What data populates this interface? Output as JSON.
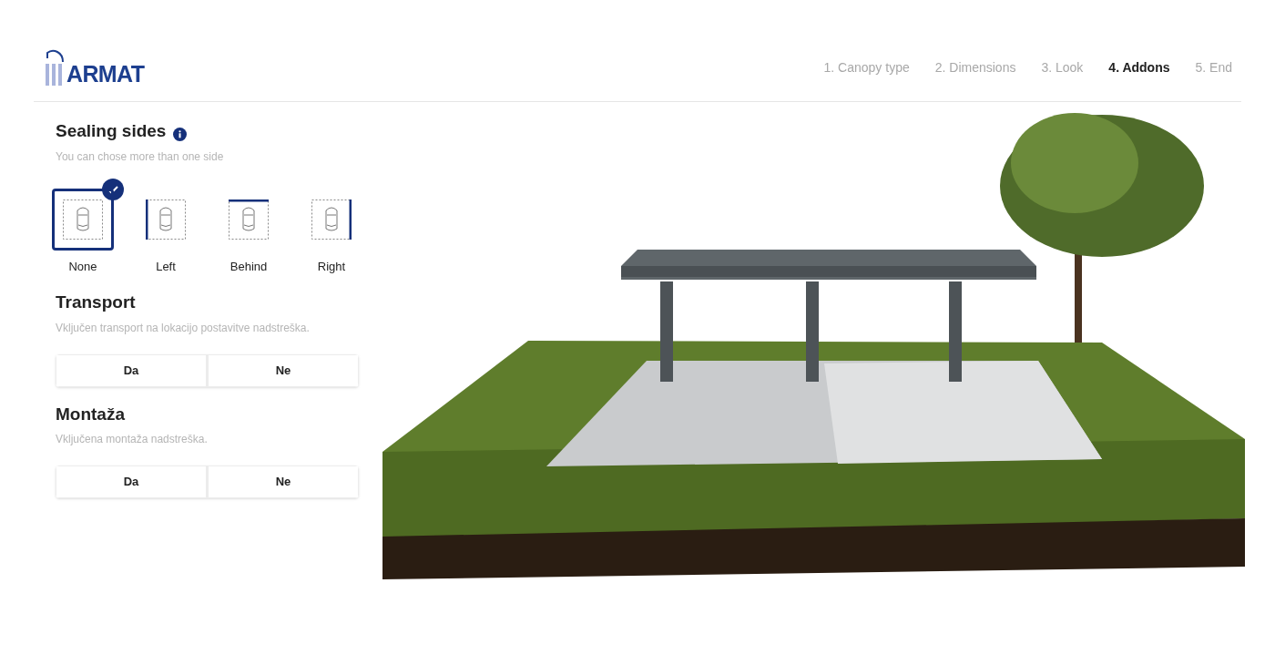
{
  "logo": {
    "text": "ARMAT"
  },
  "steps": [
    {
      "label": "1. Canopy type",
      "selected": false
    },
    {
      "label": "2. Dimensions",
      "selected": false
    },
    {
      "label": "3. Look",
      "selected": false
    },
    {
      "label": "4. Addons",
      "selected": true
    },
    {
      "label": "5. End",
      "selected": false
    }
  ],
  "sealing": {
    "title": "Sealing sides",
    "subtitle": "You can chose more than one side",
    "options": [
      {
        "label": "None",
        "kind": "none",
        "selected": true
      },
      {
        "label": "Left",
        "kind": "left",
        "selected": false
      },
      {
        "label": "Behind",
        "kind": "behind",
        "selected": false
      },
      {
        "label": "Right",
        "kind": "right",
        "selected": false
      }
    ]
  },
  "sections": [
    {
      "title": "Transport",
      "subtitle": "Vključen transport na lokacijo postavitve nadstreška.",
      "buttons": [
        "Da",
        "Ne"
      ]
    },
    {
      "title": "Montaža",
      "subtitle": "Vključena montaža nadstreška.",
      "buttons": [
        "Da",
        "Ne"
      ]
    }
  ]
}
